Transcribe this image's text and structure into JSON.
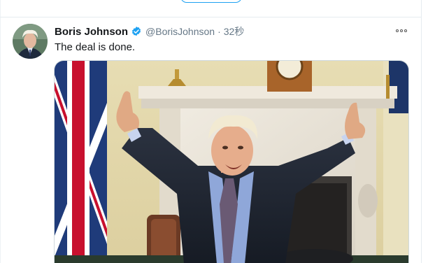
{
  "tweet": {
    "author_name": "Boris Johnson",
    "handle": "@BorisJohnson",
    "separator": "·",
    "time": "32秒",
    "text": "The deal is done."
  },
  "icons": {
    "verified": "verified-badge-icon",
    "more": "more-options-icon"
  },
  "colors": {
    "accent": "#1da1f2",
    "name": "#14171a",
    "secondary": "#657786"
  }
}
